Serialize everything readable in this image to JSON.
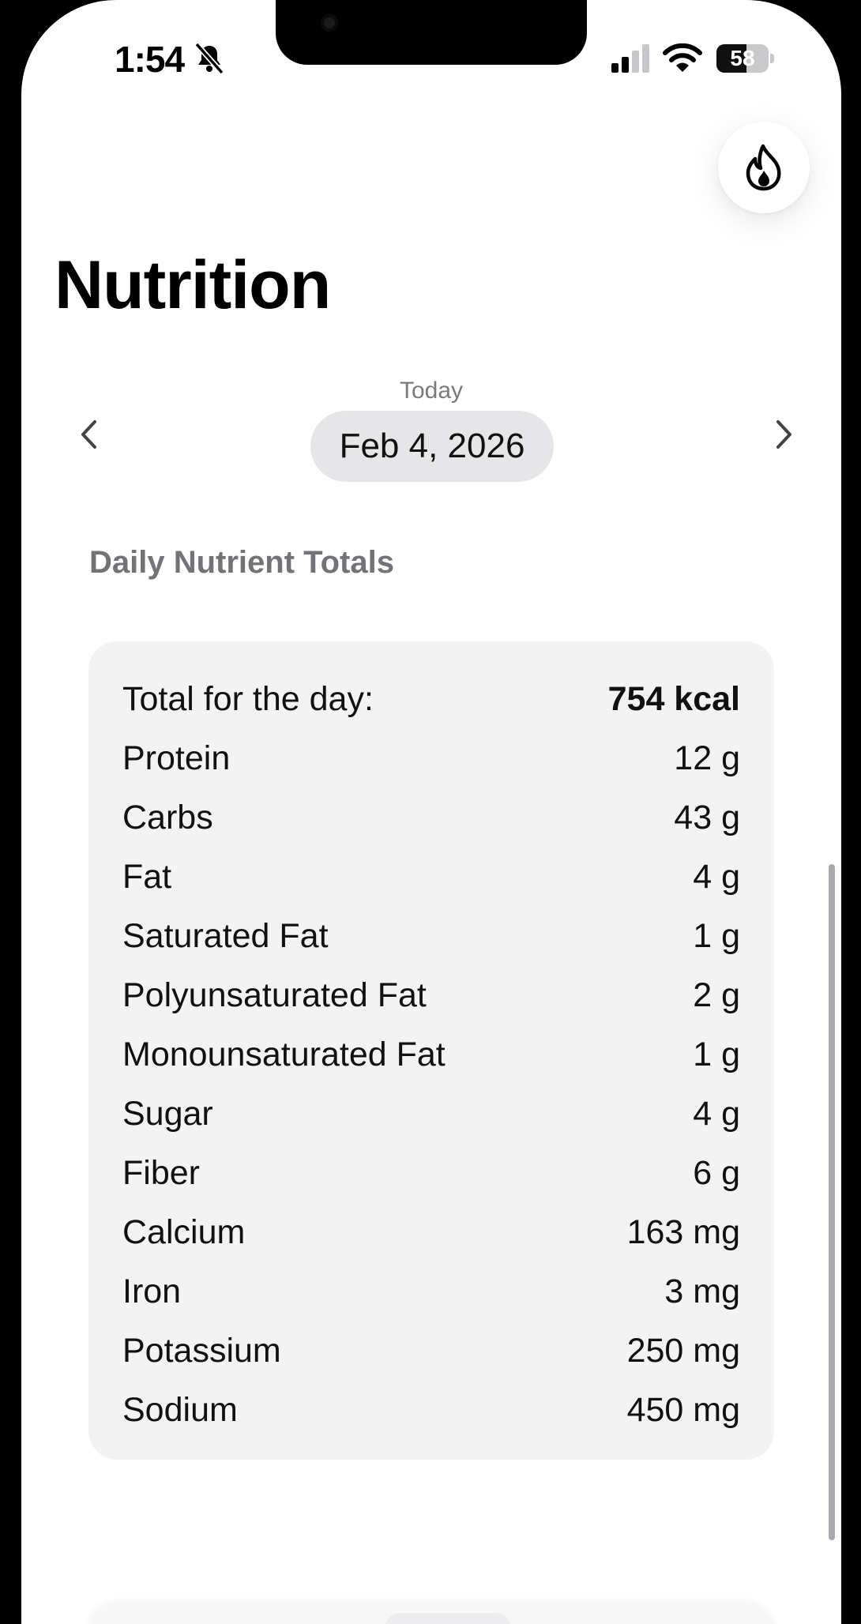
{
  "status_bar": {
    "time": "1:54",
    "battery_level": 58,
    "battery_label": "58",
    "silent_icon": "bell-slash-icon",
    "signal_icon": "cellular-signal-icon",
    "wifi_icon": "wifi-icon"
  },
  "header": {
    "title": "Nutrition",
    "streak_icon": "flame-icon"
  },
  "date_nav": {
    "caption": "Today",
    "date": "Feb 4, 2026",
    "prev_icon": "chevron-left-icon",
    "next_icon": "chevron-right-icon"
  },
  "section": {
    "heading": "Daily Nutrient Totals"
  },
  "totals": {
    "rows": [
      {
        "label": "Total for the day:",
        "value": "754 kcal"
      },
      {
        "label": "Protein",
        "value": "12 g"
      },
      {
        "label": "Carbs",
        "value": "43 g"
      },
      {
        "label": "Fat",
        "value": "4 g"
      },
      {
        "label": "Saturated Fat",
        "value": "1 g"
      },
      {
        "label": "Polyunsaturated Fat",
        "value": "2 g"
      },
      {
        "label": "Monounsaturated Fat",
        "value": "1 g"
      },
      {
        "label": "Sugar",
        "value": "4 g"
      },
      {
        "label": "Fiber",
        "value": "6 g"
      },
      {
        "label": "Calcium",
        "value": "163 mg"
      },
      {
        "label": "Iron",
        "value": "3 mg"
      },
      {
        "label": "Potassium",
        "value": "250 mg"
      },
      {
        "label": "Sodium",
        "value": "450 mg"
      }
    ]
  },
  "colors": {
    "background": "#ffffff",
    "card": "#f3f3f4",
    "date_pill": "#e6e6e8",
    "secondary_text": "#737377"
  }
}
